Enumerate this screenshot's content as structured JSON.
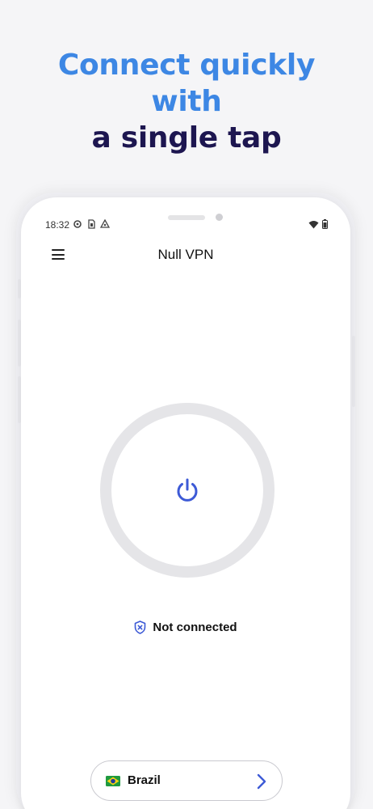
{
  "headline": {
    "line1": "Connect quickly",
    "line2": "with",
    "line3": "a single tap"
  },
  "status_bar": {
    "time": "18:32",
    "left_icons": [
      "settings-gear-icon",
      "sim-card-icon",
      "drive-icon"
    ],
    "right_icons": [
      "wifi-icon",
      "battery-icon"
    ]
  },
  "app_bar": {
    "title": "Null VPN",
    "menu_icon": "hamburger-menu-icon"
  },
  "connection": {
    "status": "Not connected",
    "status_icon": "shield-x-icon",
    "button_icon": "power-icon"
  },
  "server": {
    "country": "Brazil",
    "flag_icon": "brazil-flag-icon",
    "chevron_icon": "chevron-right-icon"
  },
  "colors": {
    "accent": "#3d5ad6",
    "headline_blue": "#3d87e4",
    "headline_dark": "#1d1650"
  }
}
